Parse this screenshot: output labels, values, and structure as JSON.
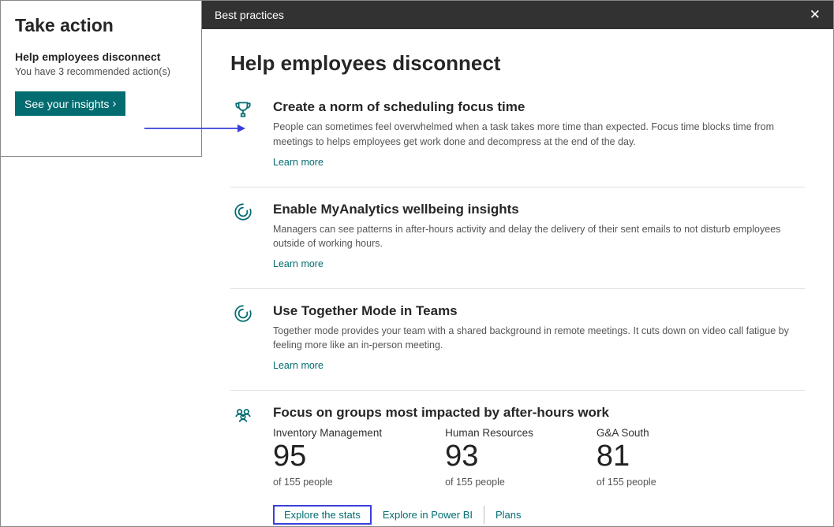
{
  "left": {
    "title": "Take action",
    "subtitle": "Help employees disconnect",
    "desc": "You have 3 recommended action(s)",
    "button_label": "See your insights"
  },
  "panel": {
    "header": "Best practices",
    "heading": "Help employees disconnect",
    "practices": [
      {
        "icon": "trophy-icon",
        "title": "Create a norm of scheduling focus time",
        "desc": "People can sometimes feel overwhelmed when a task takes more time than expected. Focus time blocks time from meetings to helps employees get work done and decompress at the end of the day.",
        "link": "Learn more"
      },
      {
        "icon": "loading-arc-icon",
        "title": "Enable MyAnalytics wellbeing insights",
        "desc": "Managers can see patterns in after-hours activity and delay the delivery of their sent emails to not disturb employees outside of working hours.",
        "link": "Learn more"
      },
      {
        "icon": "loading-arc-icon",
        "title": "Use Together Mode in Teams",
        "desc": "Together mode provides your team with a shared background in remote meetings. It cuts down on video call fatigue by feeling more like an in-person meeting.",
        "link": "Learn more"
      }
    ],
    "groups": {
      "icon": "people-icon",
      "title": "Focus on groups most impacted by after-hours work",
      "stats": [
        {
          "label": "Inventory Management",
          "num": "95",
          "of": "of 155 people"
        },
        {
          "label": "Human Resources",
          "num": "93",
          "of": "of 155 people"
        },
        {
          "label": "G&A South",
          "num": "81",
          "of": "of 155 people"
        }
      ]
    },
    "bottom_links": {
      "explore_stats": "Explore the stats",
      "explore_pbi": "Explore in Power BI",
      "plans": "Plans"
    }
  }
}
